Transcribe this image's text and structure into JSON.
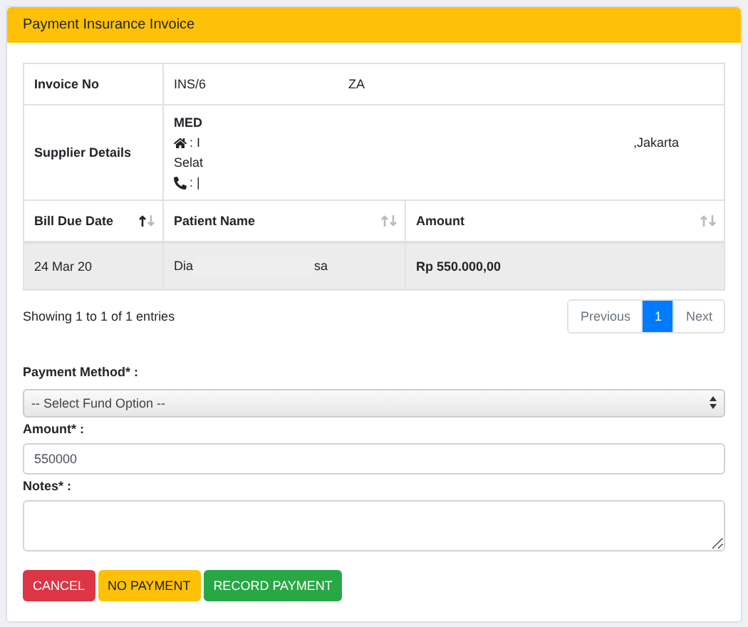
{
  "card": {
    "title": "Payment Insurance Invoice"
  },
  "details": [
    {
      "kind": "invoice",
      "label": "Invoice No",
      "parts": [
        "INS/6",
        "ZA"
      ]
    },
    {
      "kind": "supplier",
      "label": "Supplier Details",
      "name": "MED",
      "address_start": ": I",
      "address_end": ",Jakarta",
      "address_line2": "Selat",
      "phone": ": |"
    }
  ],
  "table": {
    "columns": [
      {
        "label": "Bill Due Date",
        "sorted_ascending": true
      },
      {
        "label": "Patient Name",
        "sorted_ascending": false
      },
      {
        "label": "Amount",
        "sorted_ascending": false
      }
    ],
    "rows": [
      {
        "cells": [
          "24 Mar 20",
          {
            "start": "Dia",
            "end": "sa"
          },
          "Rp 550.000,00"
        ]
      }
    ]
  },
  "table_info": "Showing 1 to 1 of 1 entries",
  "pagination": [
    {
      "label": "Previous",
      "selected": false
    },
    {
      "label": "1",
      "selected": true
    },
    {
      "label": "Next",
      "selected": false
    }
  ],
  "form": {
    "payment_method": {
      "label": "Payment Method* :",
      "value": "-- Select Fund Option --"
    },
    "amount": {
      "label": "Amount* :",
      "value": "550000"
    },
    "notes": {
      "label": "Notes* :"
    }
  },
  "buttons": [
    {
      "label": "CANCEL",
      "kind": "danger"
    },
    {
      "label": "NO PAYMENT",
      "kind": "warning"
    },
    {
      "label": "RECORD PAYMENT",
      "kind": "success"
    }
  ]
}
